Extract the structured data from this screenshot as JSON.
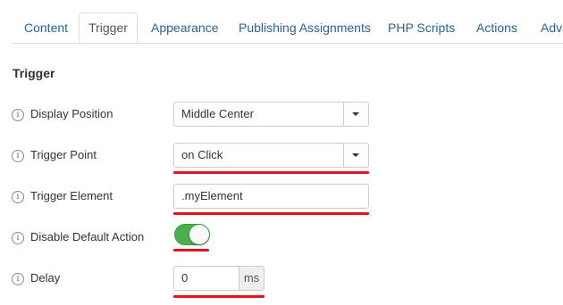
{
  "tabs": [
    {
      "label": "Content",
      "active": false
    },
    {
      "label": "Trigger",
      "active": true
    },
    {
      "label": "Appearance",
      "active": false
    },
    {
      "label": "Publishing Assignments",
      "active": false
    },
    {
      "label": "PHP Scripts",
      "active": false
    },
    {
      "label": "Actions",
      "active": false
    },
    {
      "label": "Adva",
      "active": false
    }
  ],
  "section_title": "Trigger",
  "fields": {
    "display_position": {
      "label": "Display Position",
      "value": "Middle Center",
      "icon": "info-icon"
    },
    "trigger_point": {
      "label": "Trigger Point",
      "value": "on Click",
      "icon": "info-icon"
    },
    "trigger_element": {
      "label": "Trigger Element",
      "value": ".myElement",
      "icon": "info-icon"
    },
    "disable_default_action": {
      "label": "Disable Default Action",
      "enabled": true,
      "icon": "info-icon"
    },
    "delay": {
      "label": "Delay",
      "value": "0",
      "unit": "ms",
      "icon": "info-icon"
    }
  },
  "info_glyph": "i",
  "colors": {
    "link": "#2a6496",
    "toggle_on": "#4cae4c",
    "highlight_underline": "#e3141b"
  }
}
